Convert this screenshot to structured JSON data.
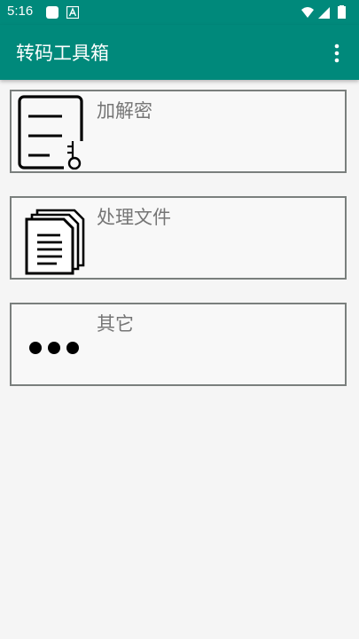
{
  "status_bar": {
    "time": "5:16",
    "icons": [
      "notification-square-icon",
      "app-a-icon",
      "wifi-icon",
      "signal-icon",
      "battery-icon"
    ]
  },
  "app_bar": {
    "title": "转码工具箱",
    "menu_icon": "overflow-menu-icon"
  },
  "menu_items": [
    {
      "label": "加解密",
      "icon": "encrypt-document-key-icon"
    },
    {
      "label": "处理文件",
      "icon": "documents-icon"
    },
    {
      "label": "其它",
      "icon": "more-dots-icon"
    }
  ],
  "colors": {
    "primary": "#00897b",
    "background": "#f5f5f5",
    "card_border": "#7a7f7d",
    "label_text": "#757575"
  }
}
